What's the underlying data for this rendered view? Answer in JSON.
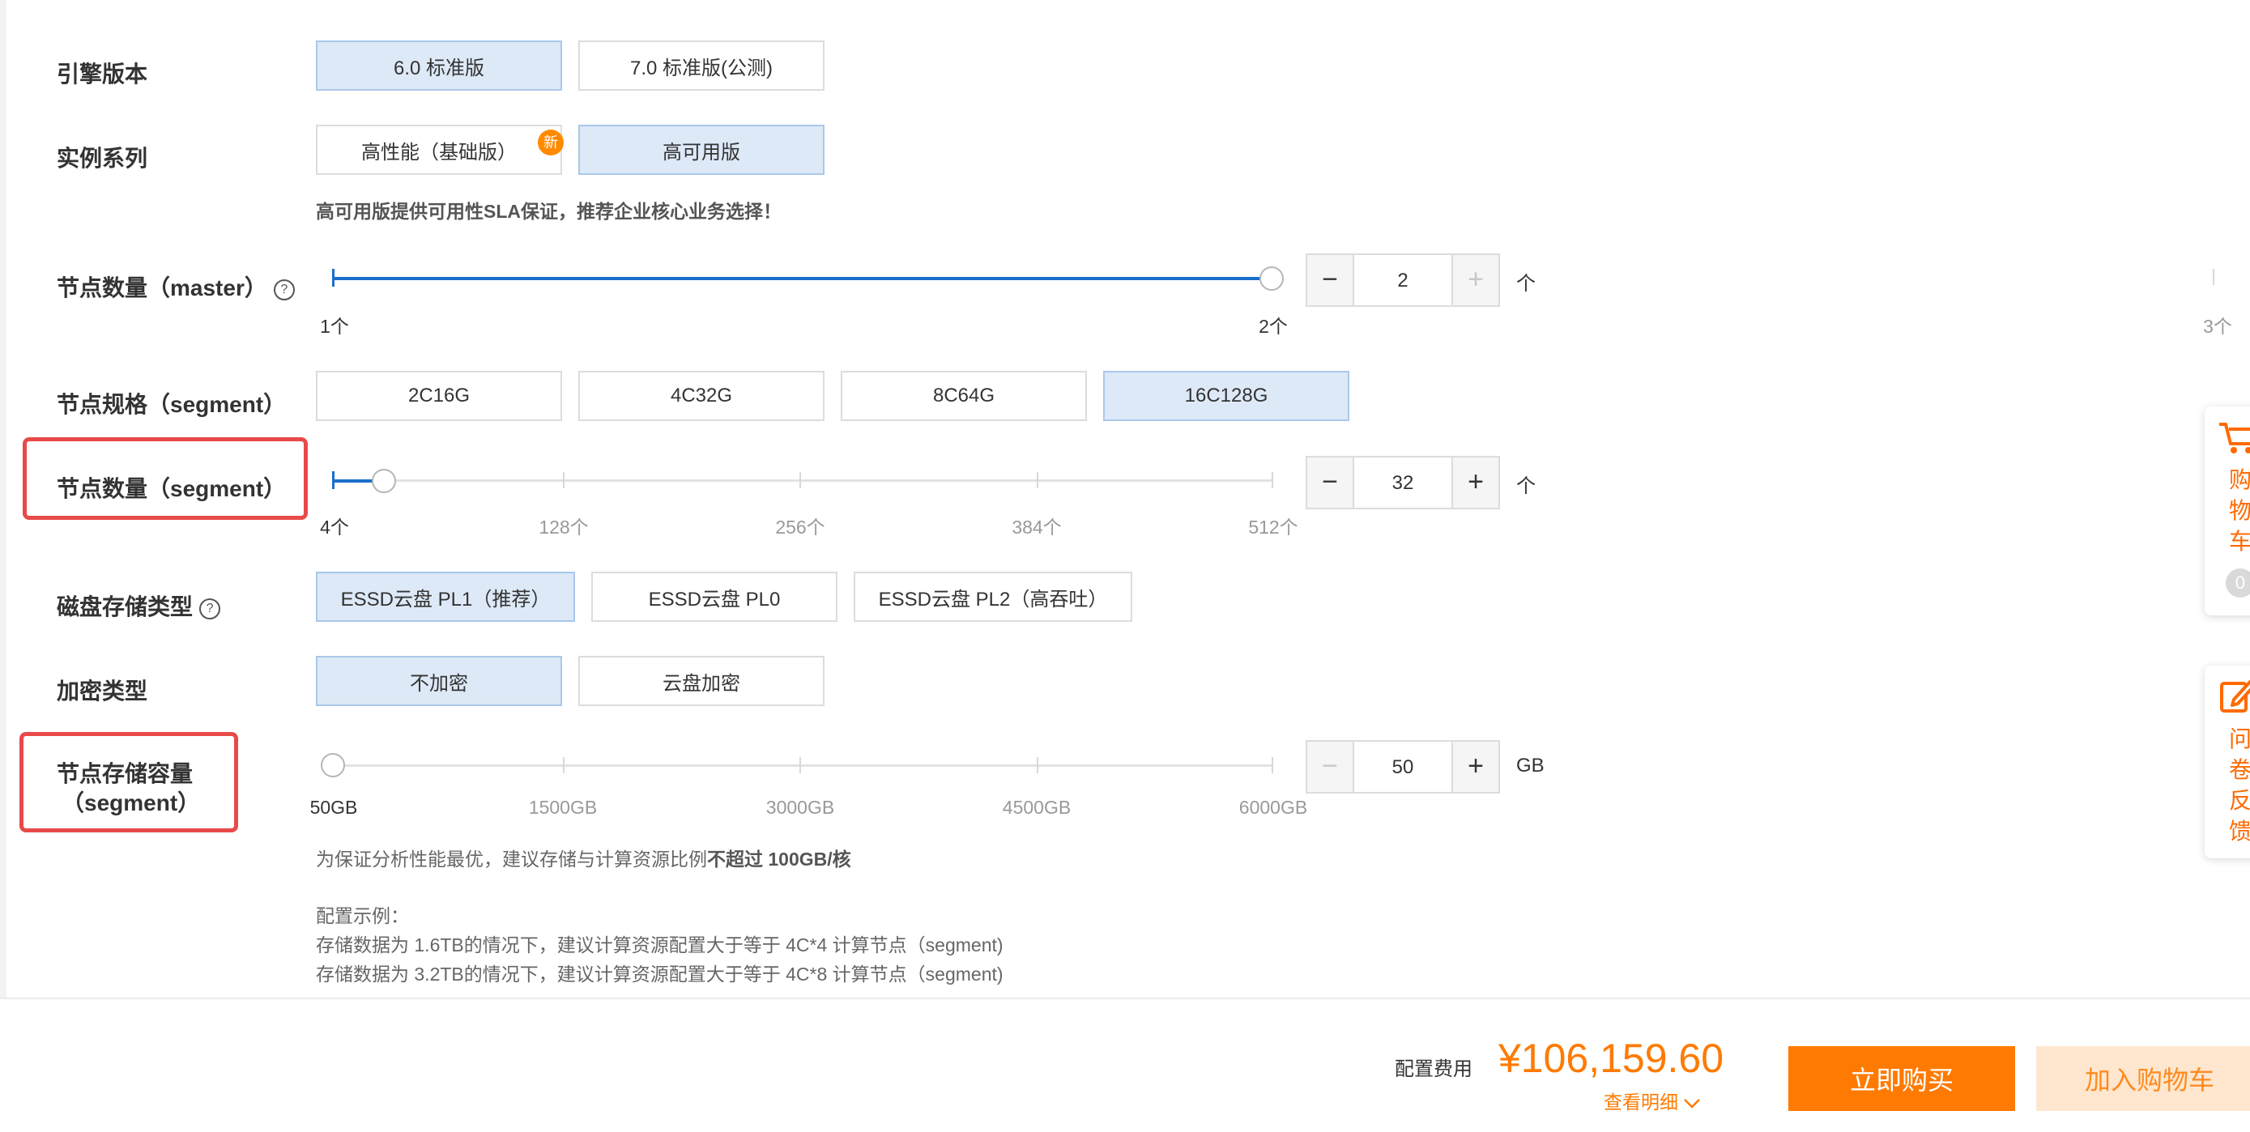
{
  "engine_version": {
    "label": "引擎版本",
    "options": [
      {
        "text": "6.0 标准版",
        "selected": true
      },
      {
        "text": "7.0 标准版(公测)",
        "selected": false
      }
    ]
  },
  "instance_series": {
    "label": "实例系列",
    "options": [
      {
        "text": "高性能（基础版）",
        "selected": false,
        "badge": "新"
      },
      {
        "text": "高可用版",
        "selected": true
      }
    ],
    "hint": "高可用版提供可用性SLA保证，推荐企业核心业务选择！"
  },
  "master_nodes": {
    "label": "节点数量（master）",
    "help_icon": "?",
    "min_label": "1个",
    "mid_label": "2个",
    "max_label": "3个",
    "value": "2",
    "unit": "个",
    "position_fraction": 0.5
  },
  "segment_spec": {
    "label": "节点规格（segment）",
    "options": [
      {
        "text": "2C16G",
        "selected": false
      },
      {
        "text": "4C32G",
        "selected": false
      },
      {
        "text": "8C64G",
        "selected": false
      },
      {
        "text": "16C128G",
        "selected": true
      }
    ]
  },
  "segment_nodes": {
    "label": "节点数量（segment）",
    "ticks": [
      "4个",
      "128个",
      "256个",
      "384个",
      "512个"
    ],
    "value": "32",
    "unit": "个",
    "min": 4,
    "max": 512
  },
  "disk_type": {
    "label": "磁盘存储类型",
    "help_icon": "?",
    "options": [
      {
        "text": "ESSD云盘 PL1（推荐）",
        "selected": true
      },
      {
        "text": "ESSD云盘 PL0",
        "selected": false
      },
      {
        "text": "ESSD云盘 PL2（高吞吐）",
        "selected": false
      }
    ]
  },
  "encryption": {
    "label": "加密类型",
    "options": [
      {
        "text": "不加密",
        "selected": true
      },
      {
        "text": "云盘加密",
        "selected": false
      }
    ]
  },
  "segment_storage": {
    "label_line1": "节点存储容量",
    "label_line2": "（segment）",
    "ticks": [
      "50GB",
      "1500GB",
      "3000GB",
      "4500GB",
      "6000GB"
    ],
    "value": "50",
    "unit": "GB",
    "hint_prefix": "为保证分析性能最优，建议存储与计算资源比例",
    "hint_bold": "不超过 100GB/核",
    "example_title": "配置示例：",
    "examples": [
      "存储数据为 1.6TB的情况下，建议计算资源配置大于等于 4C*4 计算节点（segment)",
      "存储数据为 3.2TB的情况下，建议计算资源配置大于等于 4C*8 计算节点（segment)"
    ]
  },
  "side_widgets": {
    "cart_text": [
      "购",
      "物",
      "车"
    ],
    "cart_count": "0",
    "feedback_text": [
      "问",
      "卷",
      "反",
      "馈"
    ],
    "cart_icon": "cart-icon",
    "feedback_icon": "edit-icon"
  },
  "footer": {
    "fee_label": "配置费用",
    "fee_value": "¥106,159.60",
    "detail_link": "查看明细",
    "buy_now": "立即购买",
    "add_cart": "加入购物车"
  },
  "colors": {
    "accent_orange": "#ff7a00",
    "selected_bg": "#dde9f7",
    "slider_blue": "#1a6fc9",
    "highlight_red": "#e84a4a"
  }
}
